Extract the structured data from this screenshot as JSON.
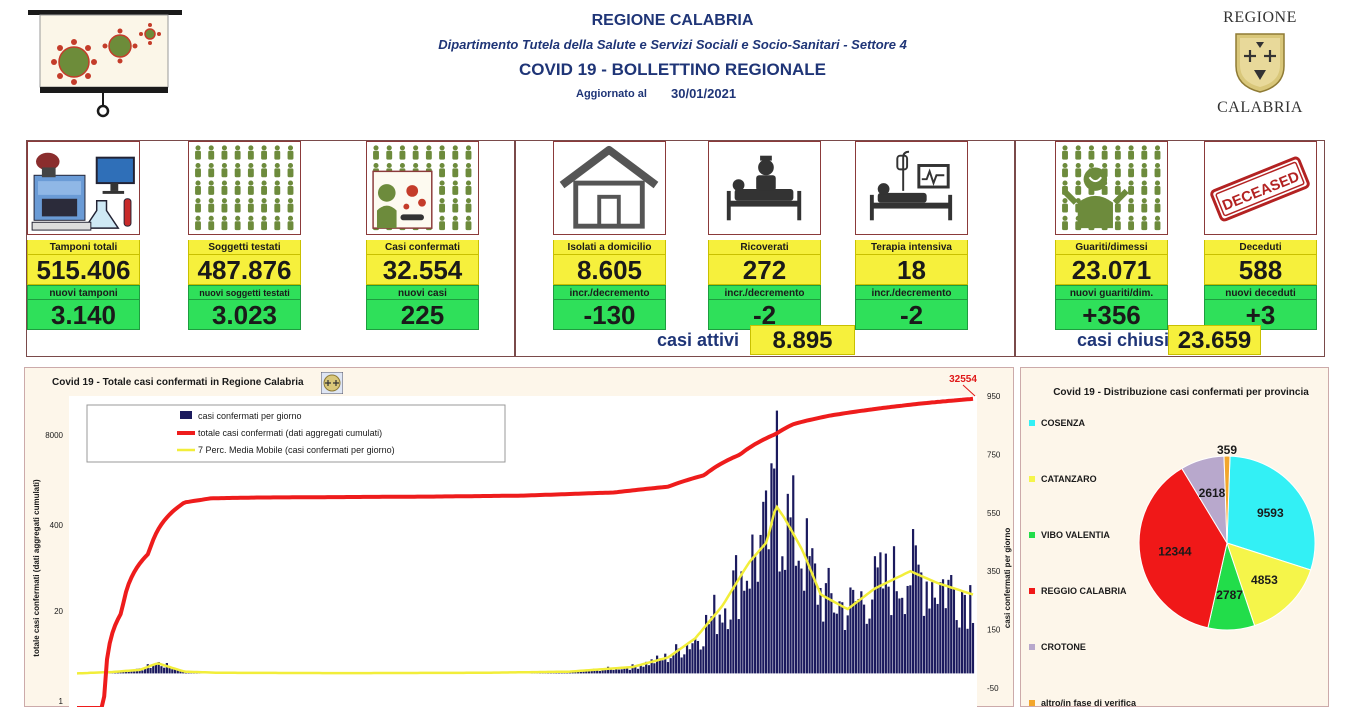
{
  "header": {
    "region": "REGIONE CALABRIA",
    "department": "Dipartimento Tutela della Salute e Servizi Sociali e Socio-Sanitari - Settore 4",
    "bulletin": "COVID 19 - BOLLETTINO REGIONALE",
    "updated_label": "Aggiornato al",
    "updated_date": "30/01/2021",
    "logo_top": "REGIONE",
    "logo_bottom": "CALABRIA"
  },
  "kpis": {
    "tamponi": {
      "label": "Tamponi totali",
      "value": "515.406",
      "sub_label": "nuovi tamponi",
      "sub_value": "3.140"
    },
    "soggetti": {
      "label": "Soggetti testati",
      "value": "487.876",
      "sub_label": "nuovi soggetti testati",
      "sub_value": "3.023"
    },
    "casi": {
      "label": "Casi confermati",
      "value": "32.554",
      "sub_label": "nuovi casi",
      "sub_value": "225"
    },
    "isolati": {
      "label": "Isolati a domicilio",
      "value": "8.605",
      "sub_label": "incr./decremento",
      "sub_value": "-130"
    },
    "ricoverati": {
      "label": "Ricoverati",
      "value": "272",
      "sub_label": "incr./decremento",
      "sub_value": "-2"
    },
    "terapia": {
      "label": "Terapia intensiva",
      "value": "18",
      "sub_label": "incr./decremento",
      "sub_value": "-2"
    },
    "guariti": {
      "label": "Guariti/dimessi",
      "value": "23.071",
      "sub_label": "nuovi guariti/dim.",
      "sub_value": "+356"
    },
    "deceduti": {
      "label": "Deceduti",
      "value": "588",
      "sub_label": "nuovi deceduti",
      "sub_value": "+3"
    }
  },
  "summary": {
    "active_label": "casi attivi",
    "active_value": "8.895",
    "closed_label": "casi chiusi",
    "closed_value": "23.659"
  },
  "deceased_stamp": "DECEASED",
  "colors": {
    "yellow": "#f6f03c",
    "green": "#2fe05a",
    "navy": "#1f3577",
    "red": "#ee1c1c",
    "bars": "#1b1a5e",
    "mean": "#f2ee3a"
  },
  "chart_data": [
    {
      "type": "bar+line",
      "title": "Covid 19 - Totale casi confermati in Regione Calabria",
      "ylabel_left": "totale casi confermati (dati aggregati cumulati)",
      "ylabel_right": "casi confermati per giorno",
      "left_ticks": [
        "8000",
        "400",
        "20",
        "1"
      ],
      "right_ticks": [
        "950",
        "750",
        "550",
        "350",
        "150",
        "-50"
      ],
      "right_range": [
        -50,
        950
      ],
      "left_scale": "log",
      "end_label": "32554",
      "legend": [
        "casi confermati per giorno",
        "totale casi confermati (dati aggregati cumulati)",
        "7 Perc. Media Mobile (casi confermati per giorno)"
      ],
      "cumulative_keypoints": [
        [
          0,
          1
        ],
        [
          0.03,
          1
        ],
        [
          0.05,
          25
        ],
        [
          0.08,
          180
        ],
        [
          0.1,
          600
        ],
        [
          0.12,
          1000
        ],
        [
          0.15,
          1150
        ],
        [
          0.2,
          1180
        ],
        [
          0.3,
          1200
        ],
        [
          0.4,
          1220
        ],
        [
          0.5,
          1260
        ],
        [
          0.6,
          1400
        ],
        [
          0.66,
          1700
        ],
        [
          0.7,
          2500
        ],
        [
          0.74,
          5000
        ],
        [
          0.78,
          10000
        ],
        [
          0.8,
          14000
        ],
        [
          0.84,
          18500
        ],
        [
          0.9,
          24000
        ],
        [
          0.95,
          28500
        ],
        [
          1.0,
          32554
        ]
      ],
      "daily_keypoints": [
        [
          0,
          0
        ],
        [
          0.04,
          5
        ],
        [
          0.07,
          12
        ],
        [
          0.09,
          35
        ],
        [
          0.1,
          25
        ],
        [
          0.12,
          6
        ],
        [
          0.16,
          2
        ],
        [
          0.3,
          1
        ],
        [
          0.45,
          2
        ],
        [
          0.55,
          6
        ],
        [
          0.62,
          22
        ],
        [
          0.66,
          55
        ],
        [
          0.69,
          120
        ],
        [
          0.72,
          230
        ],
        [
          0.75,
          380
        ],
        [
          0.77,
          450
        ],
        [
          0.78,
          575
        ],
        [
          0.79,
          530
        ],
        [
          0.81,
          420
        ],
        [
          0.83,
          270
        ],
        [
          0.86,
          220
        ],
        [
          0.89,
          290
        ],
        [
          0.91,
          320
        ],
        [
          0.93,
          350
        ],
        [
          0.96,
          310
        ],
        [
          1.0,
          270
        ]
      ],
      "daily_peak": 900
    },
    {
      "type": "pie",
      "title": "Covid 19 - Distribuzione casi confermati per provincia",
      "slices": [
        {
          "name": "COSENZA",
          "value": 9593,
          "color": "#33f0f5"
        },
        {
          "name": "CATANZARO",
          "value": 4853,
          "color": "#f5f54a"
        },
        {
          "name": "VIBO VALENTIA",
          "value": 2787,
          "color": "#22dd4a"
        },
        {
          "name": "REGGIO CALABRIA",
          "value": 12344,
          "color": "#f01818"
        },
        {
          "name": "CROTONE",
          "value": 2618,
          "color": "#b8a8cc"
        },
        {
          "name": "altro/in fase di verifica",
          "value": 359,
          "color": "#f2a62c"
        }
      ]
    }
  ]
}
